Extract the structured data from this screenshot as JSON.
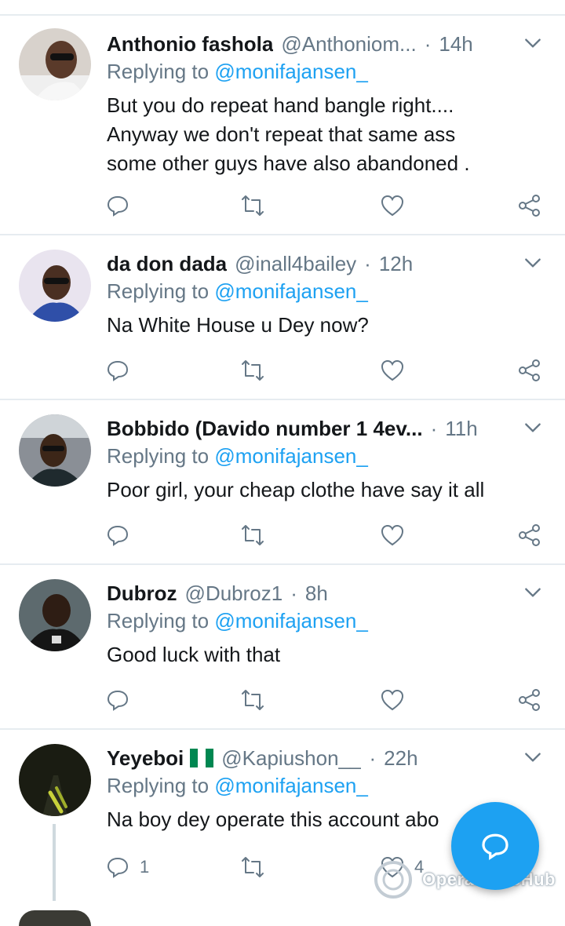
{
  "reply_prefix": "Replying to",
  "tweets": [
    {
      "name": "Anthonio fashola",
      "handle": "@Anthoniom...",
      "time": "14h",
      "mention": "@monifajansen_",
      "text": "But you do repeat hand bangle right....\nAnyway we don't repeat that same ass\nsome other guys have also abandoned .",
      "reply_count": "",
      "like_count": ""
    },
    {
      "name": "da don dada",
      "handle": "@inall4bailey",
      "time": "12h",
      "mention": "@monifajansen_",
      "text": "Na White House u Dey now?",
      "reply_count": "",
      "like_count": ""
    },
    {
      "name": "Bobbido (Davido number 1 4ev...",
      "handle": "",
      "time": "11h",
      "mention": "@monifajansen_",
      "text": "Poor girl, your cheap clothe have say it all",
      "reply_count": "",
      "like_count": ""
    },
    {
      "name": "Dubroz",
      "handle": "@Dubroz1",
      "time": "8h",
      "mention": "@monifajansen_",
      "text": "Good luck with that",
      "reply_count": "",
      "like_count": ""
    },
    {
      "name": "Yeyeboi",
      "handle": "@Kapiushon__",
      "time": "22h",
      "mention": "@monifajansen_",
      "text": "Na boy dey operate this account abo",
      "reply_count": "1",
      "like_count": "4"
    }
  ],
  "watermark": "OperaNewsHub",
  "colors": {
    "accent": "#1da1f2",
    "muted": "#657786",
    "divider": "#e6ecf0",
    "flag_green": "#008751"
  },
  "icons": [
    "reply-icon",
    "retweet-icon",
    "like-icon",
    "share-icon",
    "chevron-down-icon",
    "compose-reply-icon"
  ]
}
